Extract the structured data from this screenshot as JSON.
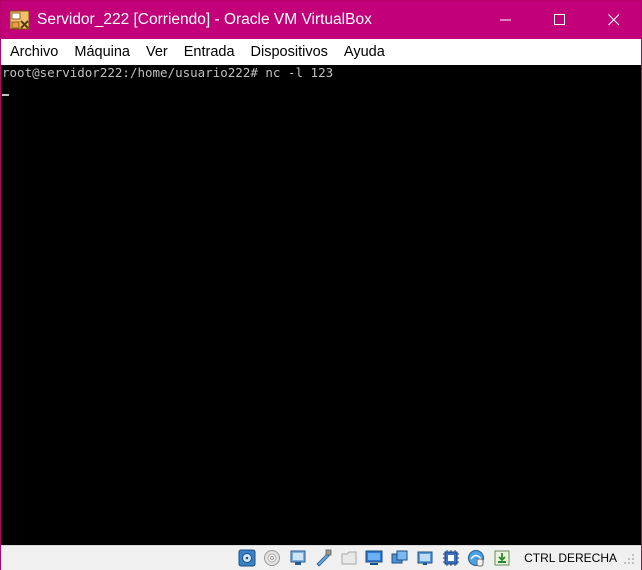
{
  "window": {
    "title": "Servidor_222 [Corriendo] - Oracle VM VirtualBox",
    "accent_color": "#c2007a",
    "icon": "virtualbox-vm-icon"
  },
  "caption_buttons": [
    {
      "name": "minimize-button",
      "icon": "minimize-icon"
    },
    {
      "name": "maximize-button",
      "icon": "maximize-icon"
    },
    {
      "name": "close-button",
      "icon": "close-icon"
    }
  ],
  "menu": {
    "items": [
      "Archivo",
      "Máquina",
      "Ver",
      "Entrada",
      "Dispositivos",
      "Ayuda"
    ]
  },
  "terminal": {
    "lines": [
      "root@servidor222:/home/usuario222# nc -l 123"
    ],
    "background": "#000000",
    "foreground": "#c0c0c0"
  },
  "statusbar": {
    "icons": [
      "hard-disk-icon",
      "optical-drive-icon",
      "audio-icon",
      "network-icon",
      "usb-icon",
      "shared-folders-icon",
      "display-icon",
      "recording-icon",
      "cpu-virtualization-icon",
      "mouse-integration-icon",
      "keyboard-capture-icon"
    ],
    "host_key": "CTRL DERECHA"
  }
}
